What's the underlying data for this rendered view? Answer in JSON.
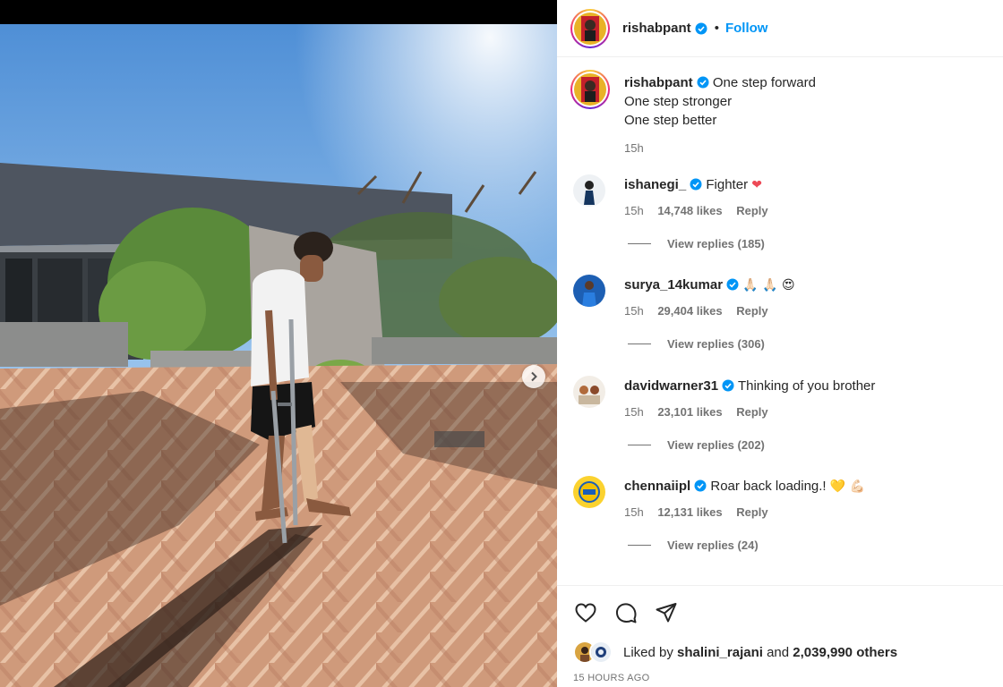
{
  "post": {
    "username": "rishabpant",
    "follow_label": "Follow",
    "separator": "•",
    "caption_lines": [
      "One step forward",
      "One step stronger",
      "One step better"
    ],
    "caption_time": "15h"
  },
  "comments": [
    {
      "username": "ishanegi_",
      "text": "Fighter",
      "emoji": "❤",
      "time": "15h",
      "likes": "14,748 likes",
      "reply": "Reply",
      "view_replies": "View replies (185)"
    },
    {
      "username": "surya_14kumar",
      "text": "",
      "emoji": "🙏🏻 🙏🏻 😍",
      "time": "15h",
      "likes": "29,404 likes",
      "reply": "Reply",
      "view_replies": "View replies (306)"
    },
    {
      "username": "davidwarner31",
      "text": "Thinking of you brother",
      "emoji": "",
      "time": "15h",
      "likes": "23,101 likes",
      "reply": "Reply",
      "view_replies": "View replies (202)"
    },
    {
      "username": "chennaiipl",
      "text": "Roar back loading.!",
      "emoji": "💛 💪🏻",
      "time": "15h",
      "likes": "12,131 likes",
      "reply": "Reply",
      "view_replies": "View replies (24)"
    }
  ],
  "likes": {
    "prefix": "Liked by",
    "user": "shalini_rajani",
    "and": "and",
    "count": "2,039,990 others"
  },
  "timestamp": "15 HOURS AGO",
  "icons": [
    "verified-badge-icon",
    "heart-icon",
    "comment-icon",
    "share-icon",
    "chevron-right-icon"
  ],
  "colors": {
    "accent": "#0095f6",
    "muted": "#737373",
    "text": "#262626",
    "heart": "#ed4956"
  }
}
